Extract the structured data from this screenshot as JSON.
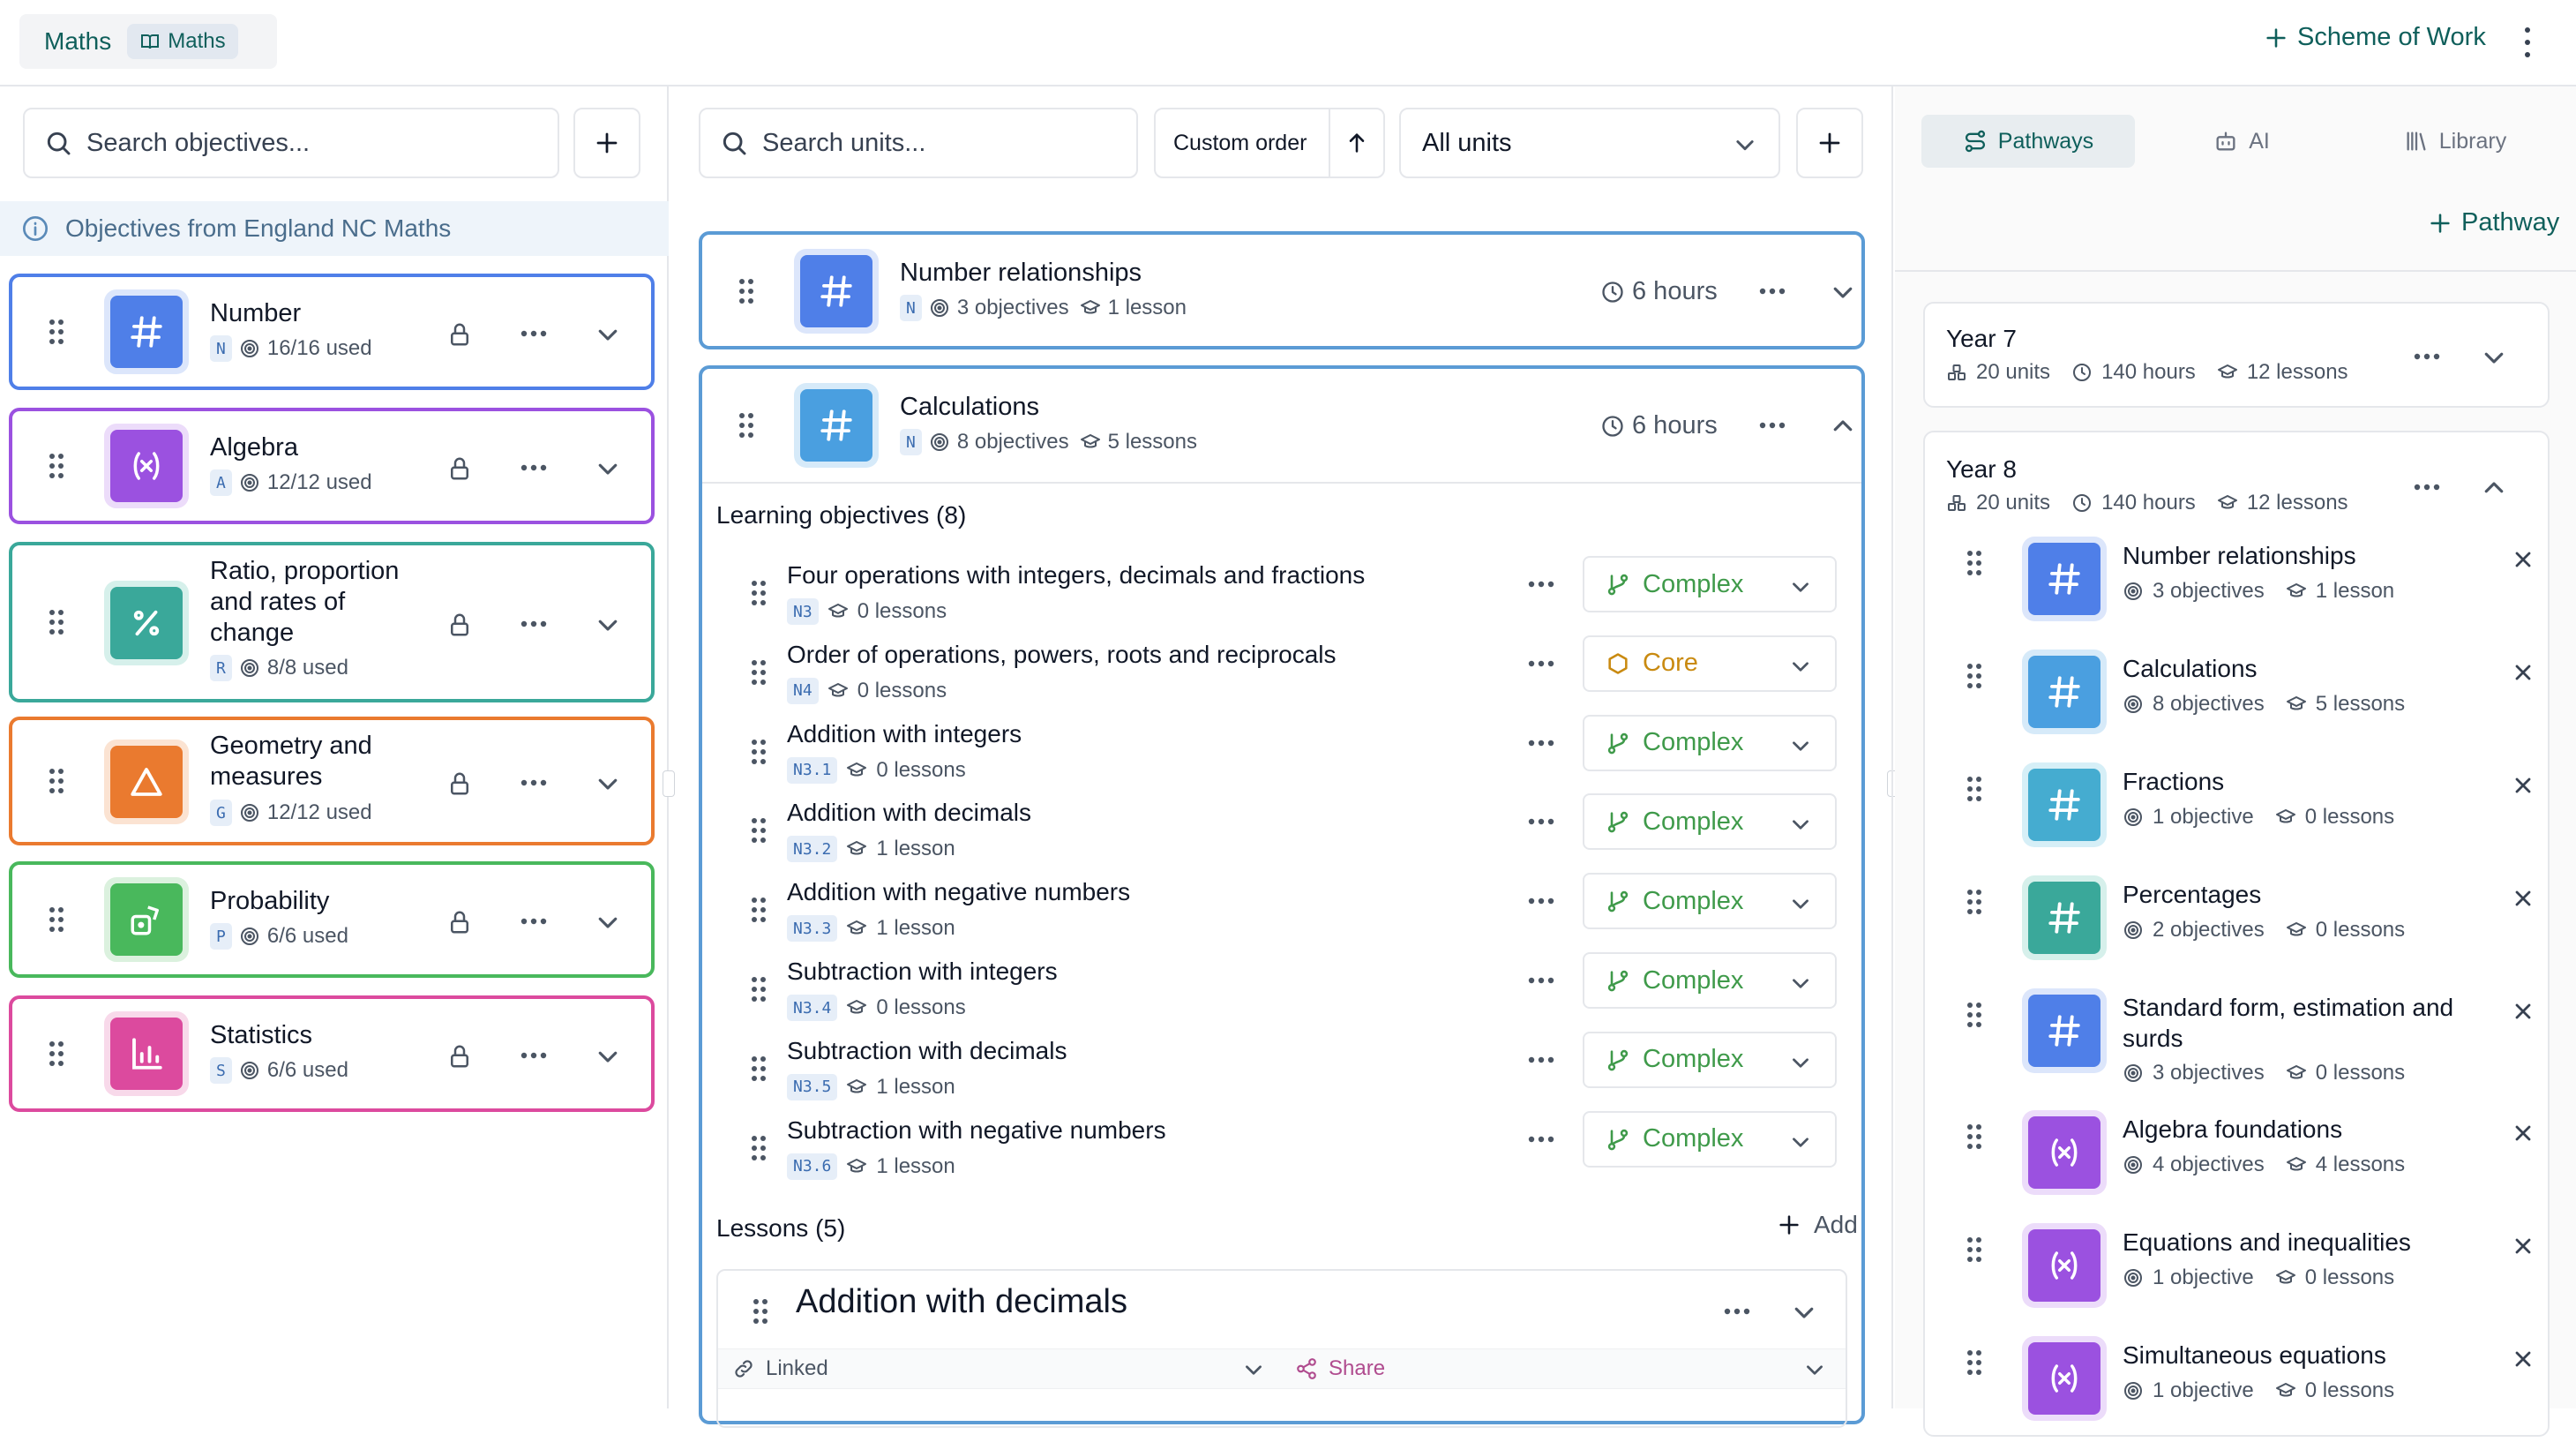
{
  "topbar": {
    "subject": "Maths",
    "subject_badge": "Maths",
    "scheme_button": "Scheme of Work"
  },
  "objectives_panel": {
    "search_placeholder": "Search objectives...",
    "info": "Objectives from England NC Maths",
    "strands": [
      {
        "title": "Number",
        "code": "N",
        "used": "16/16 used",
        "color": "#4f7fe8",
        "icon": "hash-icon"
      },
      {
        "title": "Algebra",
        "code": "A",
        "used": "12/12 used",
        "color": "#9b51e0",
        "icon": "function-icon"
      },
      {
        "title": "Ratio, proportion and rates of change",
        "code": "R",
        "used": "8/8 used",
        "color": "#3aa89a",
        "icon": "percent-icon"
      },
      {
        "title": "Geometry and measures",
        "code": "G",
        "used": "12/12 used",
        "color": "#ea7a2f",
        "icon": "triangle-icon"
      },
      {
        "title": "Probability",
        "code": "P",
        "used": "6/6 used",
        "color": "#49b85c",
        "icon": "dice-icon"
      },
      {
        "title": "Statistics",
        "code": "S",
        "used": "6/6 used",
        "color": "#dc4a9e",
        "icon": "bar-chart-icon"
      }
    ]
  },
  "units_panel": {
    "search_placeholder": "Search units...",
    "order_label": "Custom order",
    "filter_label": "All units",
    "units": [
      {
        "title": "Number relationships",
        "code": "N",
        "objectives": "3 objectives",
        "lessons": "1 lesson",
        "hours": "6 hours"
      },
      {
        "title": "Calculations",
        "code": "N",
        "objectives": "8 objectives",
        "lessons": "5 lessons",
        "hours": "6 hours"
      }
    ],
    "learning_objectives_heading": "Learning objectives (8)",
    "objectives": [
      {
        "name": "Four operations with integers, decimals and fractions",
        "code": "N3",
        "lessons": "0 lessons",
        "level": "Complex"
      },
      {
        "name": "Order of operations, powers, roots and reciprocals",
        "code": "N4",
        "lessons": "0 lessons",
        "level": "Core"
      },
      {
        "name": "Addition with integers",
        "code": "N3.1",
        "lessons": "0 lessons",
        "level": "Complex"
      },
      {
        "name": "Addition with decimals",
        "code": "N3.2",
        "lessons": "1 lesson",
        "level": "Complex"
      },
      {
        "name": "Addition with negative numbers",
        "code": "N3.3",
        "lessons": "1 lesson",
        "level": "Complex"
      },
      {
        "name": "Subtraction with integers",
        "code": "N3.4",
        "lessons": "0 lessons",
        "level": "Complex"
      },
      {
        "name": "Subtraction with decimals",
        "code": "N3.5",
        "lessons": "1 lesson",
        "level": "Complex"
      },
      {
        "name": "Subtraction with negative numbers",
        "code": "N3.6",
        "lessons": "1 lesson",
        "level": "Complex"
      }
    ],
    "lessons_heading": "Lessons (5)",
    "add_label": "Add",
    "lesson": {
      "title": "Addition with decimals",
      "linked": "Linked",
      "share": "Share"
    }
  },
  "pathways_panel": {
    "tabs": [
      {
        "label": "Pathways",
        "icon": "route-icon"
      },
      {
        "label": "AI",
        "icon": "bot-icon"
      },
      {
        "label": "Library",
        "icon": "library-icon"
      }
    ],
    "add_pathway": "Pathway",
    "years": [
      {
        "label": "Year 7",
        "units": "20 units",
        "hours": "140 hours",
        "lessons": "12 lessons"
      },
      {
        "label": "Year 8",
        "units": "20 units",
        "hours": "140 hours",
        "lessons": "12 lessons"
      }
    ],
    "year8_units": [
      {
        "title": "Number relationships",
        "objectives": "3 objectives",
        "lessons": "1 lesson",
        "color": "#4f7fe8",
        "icon": "hash-icon"
      },
      {
        "title": "Calculations",
        "objectives": "8 objectives",
        "lessons": "5 lessons",
        "color": "#4a9fe0",
        "icon": "hash-icon"
      },
      {
        "title": "Fractions",
        "objectives": "1 objective",
        "lessons": "0 lessons",
        "color": "#45acd0",
        "icon": "hash-icon"
      },
      {
        "title": "Percentages",
        "objectives": "2 objectives",
        "lessons": "0 lessons",
        "color": "#3aa89a",
        "icon": "hash-icon"
      },
      {
        "title": "Standard form, estimation and surds",
        "objectives": "3 objectives",
        "lessons": "0 lessons",
        "color": "#4f7fe8",
        "icon": "hash-icon"
      },
      {
        "title": "Algebra foundations",
        "objectives": "4 objectives",
        "lessons": "4 lessons",
        "color": "#9b51e0",
        "icon": "function-icon"
      },
      {
        "title": "Equations and inequalities",
        "objectives": "1 objective",
        "lessons": "0 lessons",
        "color": "#9b51e0",
        "icon": "function-icon"
      },
      {
        "title": "Simultaneous equations",
        "objectives": "1 objective",
        "lessons": "0 lessons",
        "color": "#9b51e0",
        "icon": "function-icon"
      }
    ]
  }
}
